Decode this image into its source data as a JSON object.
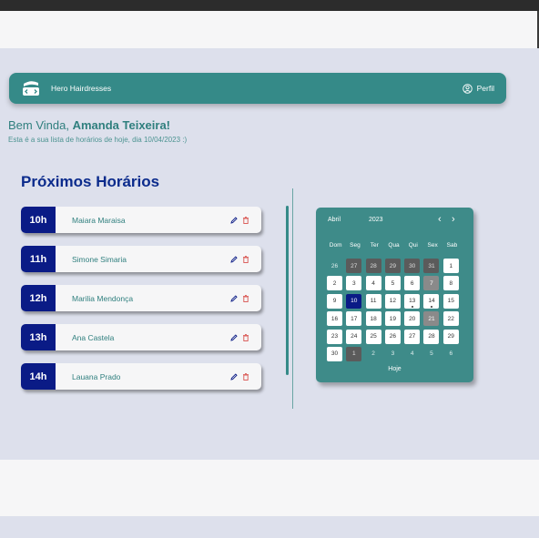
{
  "header": {
    "brand": "Hero Hairdresses",
    "profile_label": "Perfil"
  },
  "welcome": {
    "greeting": "Bem Vinda,",
    "name": "Amanda Teixeira!",
    "subtitle": "Esta é a sua lista de horários de hoje, dia  10/04/2023 :)"
  },
  "schedule": {
    "title": "Próximos Horários",
    "items": [
      {
        "hour": "10h",
        "client": "Maiara Maraisa"
      },
      {
        "hour": "11h",
        "client": "Simone Simaria"
      },
      {
        "hour": "12h",
        "client": "Marilia Mendonça"
      },
      {
        "hour": "13h",
        "client": "Ana Castela"
      },
      {
        "hour": "14h",
        "client": "Lauana Prado"
      }
    ]
  },
  "calendar": {
    "month": "Abril",
    "year": "2023",
    "prev_icon": "‹",
    "next_icon": "›",
    "weekdays": [
      "Dom",
      "Seg",
      "Ter",
      "Qua",
      "Qui",
      "Sex",
      "Sab"
    ],
    "days": [
      {
        "d": "26",
        "t": "first"
      },
      {
        "d": "27",
        "t": "prev"
      },
      {
        "d": "28",
        "t": "prev"
      },
      {
        "d": "29",
        "t": "prev"
      },
      {
        "d": "30",
        "t": "prev"
      },
      {
        "d": "31",
        "t": "prev"
      },
      {
        "d": "1",
        "t": "cur"
      },
      {
        "d": "2",
        "t": "cur"
      },
      {
        "d": "3",
        "t": "cur"
      },
      {
        "d": "4",
        "t": "cur"
      },
      {
        "d": "5",
        "t": "cur"
      },
      {
        "d": "6",
        "t": "cur"
      },
      {
        "d": "7",
        "t": "weekend"
      },
      {
        "d": "8",
        "t": "cur"
      },
      {
        "d": "9",
        "t": "cur"
      },
      {
        "d": "10",
        "t": "today"
      },
      {
        "d": "11",
        "t": "cur"
      },
      {
        "d": "12",
        "t": "cur"
      },
      {
        "d": "13",
        "t": "cur",
        "dot": true
      },
      {
        "d": "14",
        "t": "cur",
        "dot": true
      },
      {
        "d": "15",
        "t": "cur"
      },
      {
        "d": "16",
        "t": "cur"
      },
      {
        "d": "17",
        "t": "cur"
      },
      {
        "d": "18",
        "t": "cur"
      },
      {
        "d": "19",
        "t": "cur"
      },
      {
        "d": "20",
        "t": "cur"
      },
      {
        "d": "21",
        "t": "weekend"
      },
      {
        "d": "22",
        "t": "cur"
      },
      {
        "d": "23",
        "t": "cur"
      },
      {
        "d": "24",
        "t": "cur"
      },
      {
        "d": "25",
        "t": "cur"
      },
      {
        "d": "26",
        "t": "cur"
      },
      {
        "d": "27",
        "t": "cur"
      },
      {
        "d": "28",
        "t": "cur"
      },
      {
        "d": "29",
        "t": "cur"
      },
      {
        "d": "30",
        "t": "cur"
      },
      {
        "d": "1",
        "t": "nextdark"
      },
      {
        "d": "2",
        "t": "next"
      },
      {
        "d": "3",
        "t": "next"
      },
      {
        "d": "4",
        "t": "next"
      },
      {
        "d": "5",
        "t": "next"
      },
      {
        "d": "6",
        "t": "next"
      }
    ],
    "today_label": "Hoje"
  },
  "colors": {
    "teal": "#358a88",
    "navy": "#0a1b86",
    "title_blue": "#0b2b8c",
    "background": "#dde0ec",
    "delete_red": "#d9534f"
  }
}
